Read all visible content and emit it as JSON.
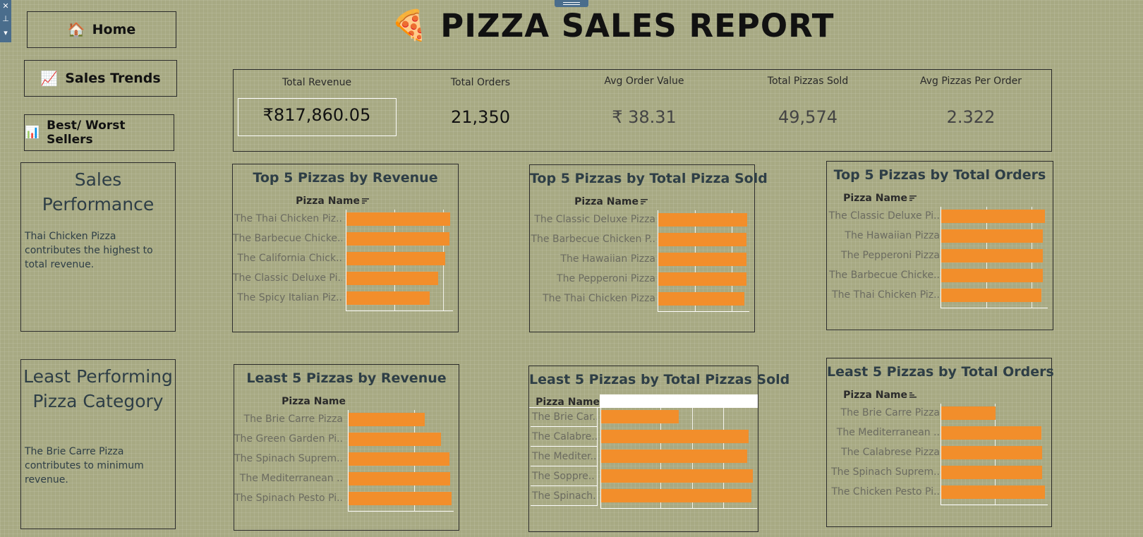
{
  "toolbar": {
    "close_glyph": "✕",
    "pin_glyph": "⊥",
    "more_glyph": "▾"
  },
  "nav": {
    "home": {
      "icon": "🏠",
      "label": "Home"
    },
    "trends": {
      "icon": "📈",
      "label": "Sales Trends"
    },
    "sellers": {
      "icon": "📊",
      "label": "Best/ Worst Sellers"
    }
  },
  "title": {
    "icon": "🍕",
    "text": "PIZZA SALES REPORT"
  },
  "kpis": [
    {
      "label": "Total Revenue",
      "value": "₹817,860.05"
    },
    {
      "label": "Total Orders",
      "value": "21,350"
    },
    {
      "label": "Avg Order Value",
      "value": "₹ 38.31"
    },
    {
      "label": "Total Pizzas Sold",
      "value": "49,574"
    },
    {
      "label": "Avg Pizzas Per Order",
      "value": "2.322"
    }
  ],
  "sales_performance": {
    "heading_line1": "Sales",
    "heading_line2": "Performance",
    "text": "Thai Chicken Pizza contributes the highest to total revenue."
  },
  "least_category": {
    "heading_line1": "Least Performing",
    "heading_line2": "Pizza Category",
    "text": "The Brie Carre Pizza contributes to minimum revenue."
  },
  "accent_color": "#f28e2b",
  "chart_data": [
    {
      "type": "bar",
      "title": "Top 5 Pizzas by Revenue",
      "header": "Pizza Name",
      "categories": [
        "The Thai Chicken Piz..",
        "The Barbecue Chicke..",
        "The California Chick..",
        "The Classic Deluxe Pi..",
        "The Spicy Italian Piz.."
      ],
      "values": [
        1.0,
        0.99,
        0.95,
        0.88,
        0.8
      ]
    },
    {
      "type": "bar",
      "title": "Top 5 Pizzas by Total Pizza Sold",
      "header": "Pizza Name",
      "categories": [
        "The Classic Deluxe Pizza",
        "The Barbecue Chicken P..",
        "The Hawaiian Pizza",
        "The Pepperoni Pizza",
        "The Thai Chicken Pizza"
      ],
      "values": [
        1.0,
        0.99,
        0.99,
        0.99,
        0.97
      ]
    },
    {
      "type": "bar",
      "title": "Top 5 Pizzas by Total Orders",
      "header": "Pizza Name",
      "categories": [
        "The Classic Deluxe Pi..",
        "The Hawaiian Pizza",
        "The Pepperoni Pizza",
        "The Barbecue Chicke..",
        "The Thai Chicken Piz.."
      ],
      "values": [
        1.0,
        0.98,
        0.98,
        0.98,
        0.96
      ]
    },
    {
      "type": "bar",
      "title": "Least 5 Pizzas by Revenue",
      "header": "Pizza Name",
      "categories": [
        "The Brie Carre Pizza",
        "The Green Garden Pi..",
        "The Spinach Suprem..",
        "The Mediterranean ..",
        "The Spinach Pesto Pi.."
      ],
      "values": [
        0.74,
        0.9,
        0.98,
        0.99,
        1.0
      ]
    },
    {
      "type": "bar",
      "title": "Least 5 Pizzas by Total Pizzas Sold",
      "header": "Pizza Name",
      "categories": [
        "The Brie Car..",
        "The Calabre..",
        "The Mediter..",
        "The Soppre..",
        "The Spinach.."
      ],
      "values": [
        0.51,
        0.97,
        0.96,
        1.0,
        0.99
      ]
    },
    {
      "type": "bar",
      "title": "Least 5 Pizzas by Total Orders",
      "header": "Pizza Name",
      "categories": [
        "The Brie Carre Pizza",
        "The Mediterranean ..",
        "The Calabrese Pizza",
        "The Spinach Suprem..",
        "The Chicken Pesto Pi.."
      ],
      "values": [
        0.52,
        0.96,
        0.97,
        0.97,
        1.0
      ]
    }
  ]
}
